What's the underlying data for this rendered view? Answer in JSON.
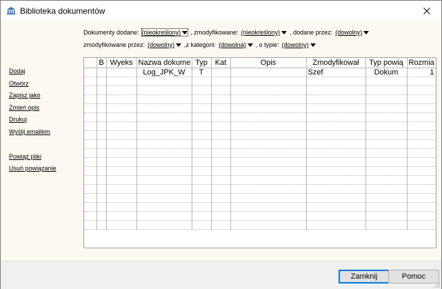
{
  "window": {
    "title": "Biblioteka dokumentów",
    "icon": "library-icon"
  },
  "filters": {
    "row1": [
      {
        "type": "label",
        "text": "Dokumenty dodane:"
      },
      {
        "type": "dropdown",
        "value": "(nieokreślony)",
        "focused": true
      },
      {
        "type": "label",
        "text": ", zmodyfikowane:"
      },
      {
        "type": "dropdown",
        "value": "(nieokreślony)"
      },
      {
        "type": "label",
        "text": ", dodane przez:"
      },
      {
        "type": "dropdown",
        "value": "(dowolny)"
      }
    ],
    "row2": [
      {
        "type": "label",
        "text": "zmodyfikowane przez:"
      },
      {
        "type": "dropdown",
        "value": "(dowolny)"
      },
      {
        "type": "label",
        "text": ",z kategorii:"
      },
      {
        "type": "dropdown",
        "value": "(dowolna)"
      },
      {
        "type": "label",
        "text": ", o typie:"
      },
      {
        "type": "dropdown",
        "value": "(dowolny)"
      }
    ]
  },
  "sidebar": {
    "group1": [
      "Dodaj",
      "Otwórz",
      "Zapisz jako",
      "Zmień opis",
      "Drukuj",
      "Wyślij emailem"
    ],
    "group2": [
      "Powiąż pliki",
      "Usuń powiązanie"
    ]
  },
  "table": {
    "columns": [
      "",
      "B",
      "Wyeks",
      "Nazwa dokume",
      "Typ",
      "Kat",
      "Opis",
      "Zmodyfikował",
      "Typ powią",
      "Rozmia"
    ],
    "rows": [
      [
        "",
        "",
        "",
        "Log_JPK_W",
        "T",
        "",
        "",
        "Szef",
        "Dokum",
        "1"
      ]
    ],
    "empty_row_count": 17
  },
  "buttons": {
    "close": "Zamknij",
    "help": "Pomoc"
  }
}
